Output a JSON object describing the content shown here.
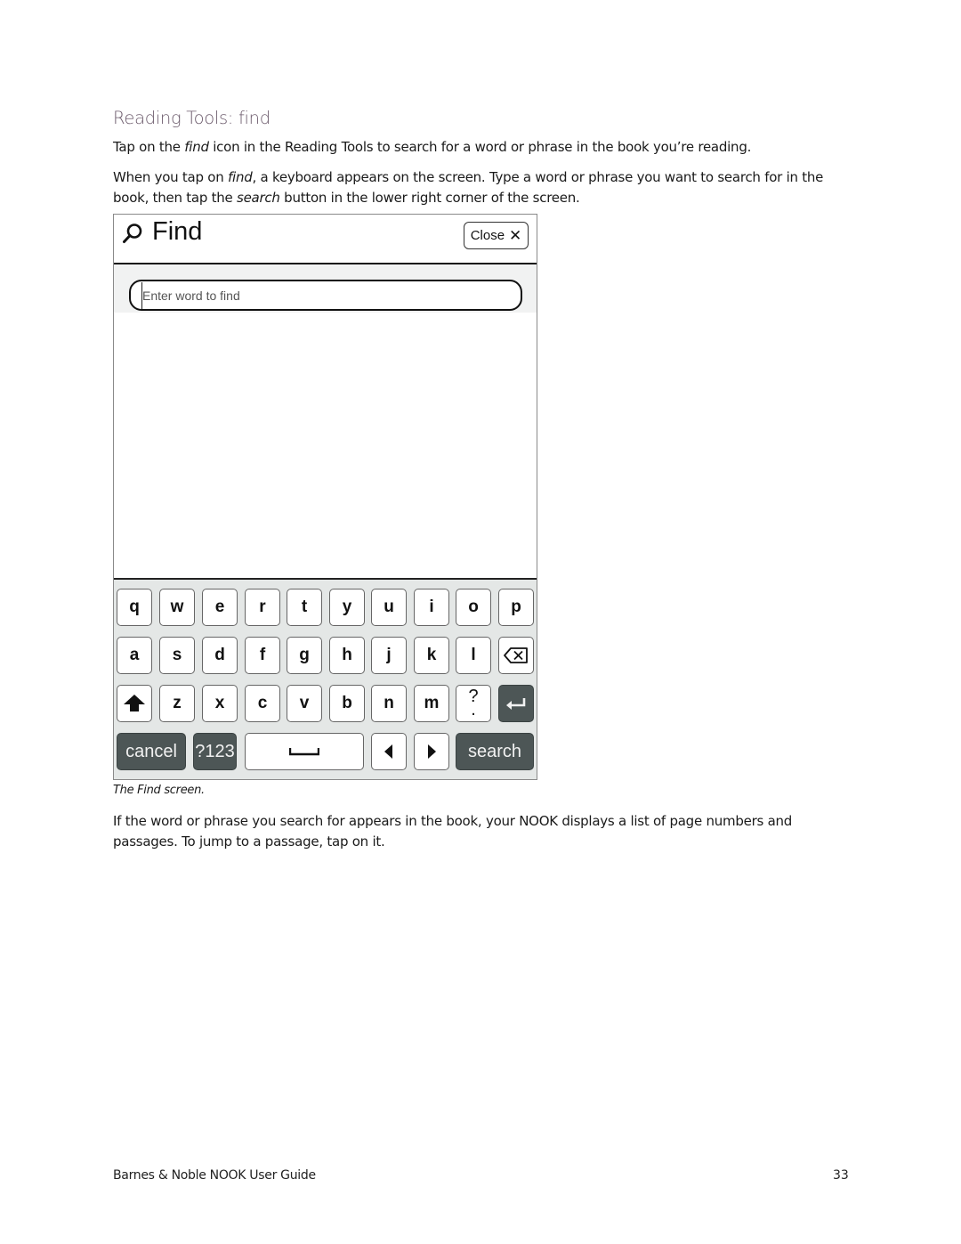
{
  "heading": "Reading Tools: find",
  "paragraph1": {
    "before": "Tap on the ",
    "em": "find",
    "after": " icon in the Reading Tools to search for a word or phrase in the book you’re reading."
  },
  "paragraph2": {
    "before": "When you tap on ",
    "em1": "find",
    "middle": ", a keyboard appears on the screen. Type a word or phrase you want to search for in the book, then tap the ",
    "em2": "search",
    "after": " button in the lower right corner of the screen."
  },
  "device": {
    "header": {
      "icon": "search-icon",
      "title": "Find",
      "close_label": "Close",
      "close_icon": "close-icon"
    },
    "search": {
      "placeholder": "Enter word to find",
      "value": ""
    },
    "keyboard": {
      "row1": [
        "q",
        "w",
        "e",
        "r",
        "t",
        "y",
        "u",
        "i",
        "o",
        "p"
      ],
      "row2": [
        "a",
        "s",
        "d",
        "f",
        "g",
        "h",
        "j",
        "k",
        "l"
      ],
      "row2_extra": {
        "icon": "backspace-icon"
      },
      "row3_start": {
        "icon": "shift-icon"
      },
      "row3": [
        "z",
        "x",
        "c",
        "v",
        "b",
        "n",
        "m"
      ],
      "row3_punct": {
        "top": "?",
        "bottom": "."
      },
      "row3_end": {
        "icon": "enter-icon"
      },
      "row4": {
        "cancel": "cancel",
        "symbols": "?123",
        "space_icon": "space-icon",
        "left_icon": "arrow-left-icon",
        "right_icon": "arrow-right-icon",
        "search": "search"
      }
    }
  },
  "caption": "The Find screen.",
  "paragraph3": "If the word or phrase you search for appears in the book, your NOOK displays a list of page numbers and passages. To jump to a passage, tap on it.",
  "footer": {
    "title": "Barnes & Noble NOOK User Guide",
    "page": "33"
  }
}
